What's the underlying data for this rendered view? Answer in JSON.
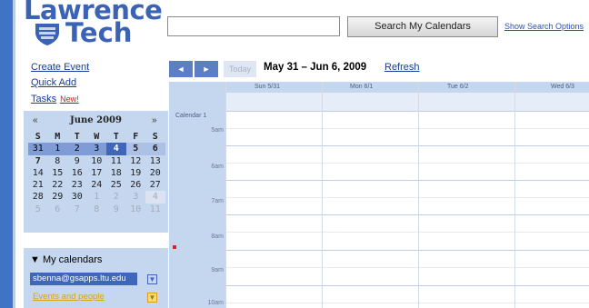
{
  "logo": {
    "line1": "Lawrence",
    "line2": "Tech",
    "brand_color": "#3b63b5",
    "icon": "shield-icon"
  },
  "search": {
    "input_value": "",
    "button_label": "Search My Calendars",
    "options_link": "Show Search Options"
  },
  "links": {
    "create_event": "Create Event",
    "quick_add": "Quick Add",
    "tasks": "Tasks",
    "new_badge": "New!"
  },
  "mini_calendar": {
    "prev": "«",
    "next": "»",
    "month_title": "June 2009",
    "days_of_week": [
      "S",
      "M",
      "T",
      "W",
      "T",
      "F",
      "S"
    ],
    "weeks": [
      [
        "31",
        "1",
        "2",
        "3",
        "4",
        "5",
        "6"
      ],
      [
        "7",
        "8",
        "9",
        "10",
        "11",
        "12",
        "13"
      ],
      [
        "14",
        "15",
        "16",
        "17",
        "18",
        "19",
        "20"
      ],
      [
        "21",
        "22",
        "23",
        "24",
        "25",
        "26",
        "27"
      ],
      [
        "28",
        "29",
        "30",
        "1",
        "2",
        "3",
        "4"
      ],
      [
        "5",
        "6",
        "7",
        "8",
        "9",
        "10",
        "11"
      ]
    ]
  },
  "my_calendars": {
    "title": "My calendars",
    "toggle_icon": "triangle-down-icon",
    "items": [
      {
        "name": "sbenna@gsapps.ltu.edu",
        "color": "#3f66b8"
      },
      {
        "name": "Events and people",
        "color": "#d7a21a"
      }
    ]
  },
  "toolbar": {
    "prev_label": "◄",
    "next_label": "►",
    "today_label": "Today",
    "date_range": "May 31 – Jun 6, 2009",
    "refresh_label": "Refresh"
  },
  "week_view": {
    "days": [
      "Sun 5/31",
      "Mon 6/1",
      "Tue 6/2",
      "Wed 6/3"
    ],
    "calendar_label": "Calendar 1",
    "hours": [
      "5am",
      "6am",
      "7am",
      "8am",
      "9am",
      "10am"
    ]
  }
}
